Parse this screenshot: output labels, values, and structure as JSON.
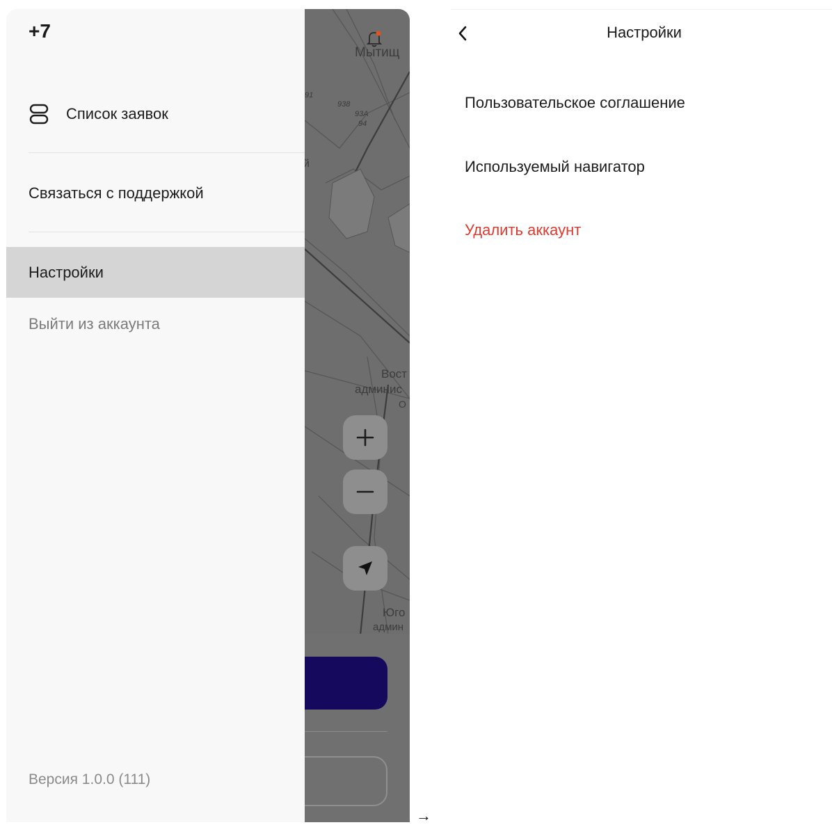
{
  "drawer": {
    "phone": "+7",
    "items": [
      {
        "label": "Список заявок",
        "icon": "list-icon"
      },
      {
        "label": "Связаться с поддержкой"
      },
      {
        "label": "Настройки",
        "active": true
      },
      {
        "label": "Выйти из аккаунта",
        "muted": true
      }
    ],
    "version": "Версия 1.0.0 (111)"
  },
  "map": {
    "labels": {
      "city": "Мытищ",
      "district_top": "Вост",
      "district_mid": "админис",
      "district_o": "О",
      "district_bottom": "Юго",
      "district_bottom2": "админ"
    },
    "route_numbers": [
      "91",
      "938",
      "93А",
      "94",
      "й"
    ],
    "buttons": [
      "plus-icon",
      "minus-icon",
      "navigation-arrow-icon"
    ],
    "notification_dot_color": "#e8501f"
  },
  "transition_arrow": "→",
  "settings": {
    "title": "Настройки",
    "items": [
      {
        "label": "Пользовательское соглашение"
      },
      {
        "label": "Используемый навигатор"
      },
      {
        "label": "Удалить аккаунт",
        "danger": true
      }
    ],
    "danger_color": "#e03a2e"
  },
  "colors": {
    "primary_button": "#15095e",
    "drawer_active": "#d5d5d5",
    "drawer_bg": "#f8f8f8"
  }
}
